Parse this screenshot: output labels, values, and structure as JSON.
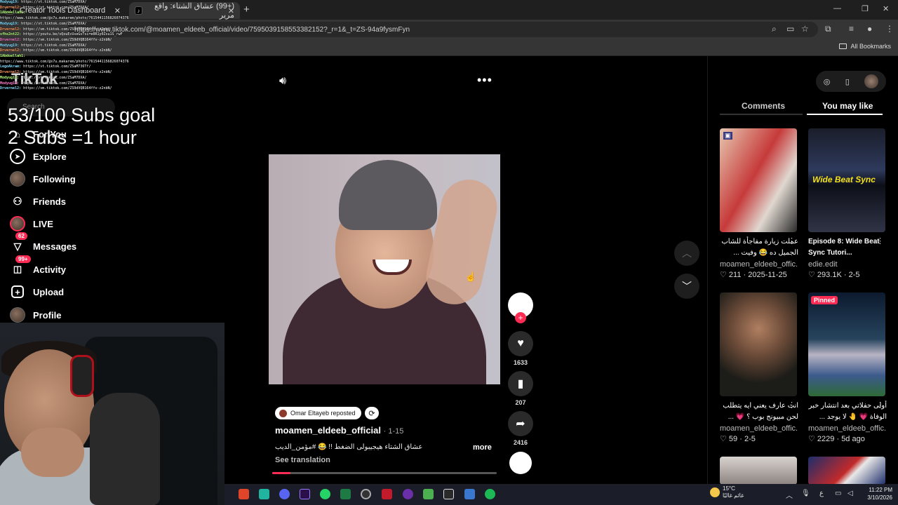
{
  "browser": {
    "tab1_title": "Creator Tools Dashboard",
    "tab2_title": "(+99) عشاق الشتاء: واقع مرير",
    "url": "https://www.tiktok.com/@moamen_eldeeb_official/video/7595039158553382152?_r=1&_t=ZS-94a9fysmFyn",
    "all_bookmarks": "All Bookmarks"
  },
  "chat": [
    {
      "user": "Modyug19",
      "msg": "https://vt.tiktok.com/ZSaM7DXA/"
    },
    {
      "user": "Drvernel2",
      "msg": "https://vt.tiktok.com/ZSaM7DXA/"
    },
    {
      "user": "1Abdoallah1",
      "msg": ""
    },
    {
      "user": "",
      "msg": "https://www.tiktok.com/@s7u.makarem/photo/7615441156826074376"
    },
    {
      "user": "Modyug19",
      "msg": "https://vt.tiktok.com/ZSaM7DXA/"
    },
    {
      "user": "Drvernel2",
      "msg": "https://vm.tiktok.com/ZS9dVQB164ffv-z2nb/"
    },
    {
      "user": "sfhs2nt22",
      "msg": "https://youtu.be/vQouEcUseGv?si=e0R1y0Zsu1S_rwF"
    },
    {
      "user": "Drvernel2",
      "msg": "https://vm.tiktok.com/ZS9dVQB164ffv-z2nbN/"
    },
    {
      "user": "Modyug19",
      "msg": "https://vt.tiktok.com/ZSaM7DXA/"
    },
    {
      "user": "Drvernel2",
      "msg": "https://vm.tiktok.com/ZS9dVQB164ffv-z2nbN/"
    },
    {
      "user": "1Abdoallah1",
      "msg": ""
    },
    {
      "user": "",
      "msg": "https://www.tiktok.com/@s7u.makarem/photo/7615441156826074376"
    },
    {
      "user": "LegoAkram",
      "msg": "https://vt.tiktok.com/ZSaM736Tf/"
    },
    {
      "user": "Drvernel2",
      "msg": "https://vm.tiktok.com/ZS9dVQB164ffv-z2nbN/"
    },
    {
      "user": "Modyug19",
      "msg": "https://vt.tiktok.com/ZSaM7DXA/"
    },
    {
      "user": "Modyug19",
      "msg": "https://vt.tiktok.com/ZSaM7DXA/"
    },
    {
      "user": "Drvernel2",
      "msg": "https://vm.tiktok.com/ZS9dVQB164ffv-z2nbN/"
    }
  ],
  "overlay": {
    "goal_line1": "53/100 Subs goal",
    "goal_line2": "2 Subs =1 hour"
  },
  "tiktok": {
    "logo": "TikTok",
    "search_placeholder": "Search",
    "nav": [
      {
        "label": "For You",
        "icon": "home-icon"
      },
      {
        "label": "Explore",
        "icon": "compass-icon"
      },
      {
        "label": "Following",
        "icon": "following-avatar"
      },
      {
        "label": "Friends",
        "icon": "friends-icon"
      },
      {
        "label": "LIVE",
        "icon": "live-avatar"
      },
      {
        "label": "Messages",
        "icon": "messages-icon",
        "badge": "62"
      },
      {
        "label": "Activity",
        "icon": "activity-icon",
        "badge": "99+"
      },
      {
        "label": "Upload",
        "icon": "upload-icon"
      },
      {
        "label": "Profile",
        "icon": "profile-avatar"
      }
    ]
  },
  "video": {
    "reposted_by": "Omar Eltayeb reposted",
    "author": "moamen_eldeeb_official",
    "date": "1-15",
    "caption": "عشاق الشتاء هيجيبولى الضغط !! 😂 #مؤمن_الديب",
    "more": "more",
    "see_translation": "See translation",
    "progress_fraction": 0.08,
    "likes": "1633",
    "saves": "207",
    "shares": "2416"
  },
  "panel": {
    "tabs": [
      "Comments",
      "You may like"
    ],
    "active_tab": "You may like",
    "cards": [
      {
        "title": "عملت زيارة مفاجأة للشاب الجميل ده 😂 وفيت ...",
        "rtl": true,
        "author": "moamen_eldeeb_offic...",
        "likes": "211",
        "date": "2025-11-25",
        "pinned": false
      },
      {
        "title": "Episode 8: Wide Beat Sync Tutori...",
        "rtl": false,
        "author": "edie.edit",
        "likes": "293.1K",
        "date": "2-5",
        "pinned": false,
        "thumb_text": "Wide Beat Sync"
      },
      {
        "title": "انت عارف يعني ايه يتطلب لحن مبيونج بوب ؟ 💗 ...",
        "rtl": true,
        "author": "moamen_eldeeb_offic...",
        "likes": "59",
        "date": "2-5",
        "pinned": false
      },
      {
        "title": "أولى حفلاتي بعد انتشار خبر الوفاة 💗 🤚 لا يوجد ...",
        "rtl": true,
        "author": "moamen_eldeeb_offic...",
        "likes": "2229",
        "date": "5d ago",
        "pinned": true,
        "pinned_label": "Pinned"
      }
    ]
  },
  "taskbar": {
    "weather_temp": "15°C",
    "weather_desc": "غائم غالبًا",
    "weather_badge": "2",
    "lang": "ع",
    "time": "11:22 PM",
    "date": "3/10/2026"
  }
}
